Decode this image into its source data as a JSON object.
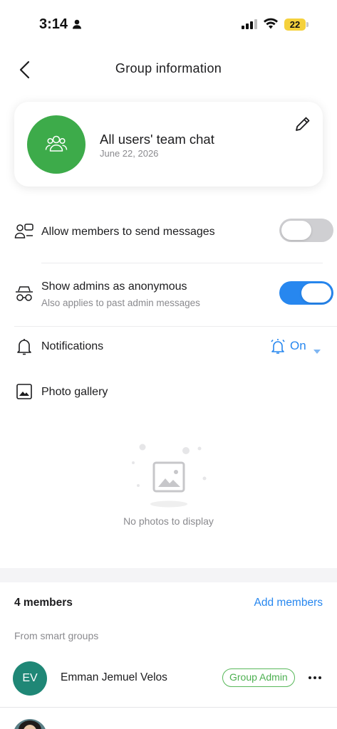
{
  "status_bar": {
    "time": "3:14",
    "battery": "22",
    "icons": [
      "person-icon",
      "signal-icon",
      "wifi-icon",
      "battery-icon"
    ]
  },
  "header": {
    "title": "Group information",
    "back_icon": "chevron-left-icon"
  },
  "group": {
    "name": "All users' team chat",
    "date": "June 22, 2026",
    "avatar_icon": "users-icon",
    "avatar_color": "#3dab4a",
    "edit_icon": "pencil-icon"
  },
  "settings": {
    "allow_messages": {
      "label": "Allow members to send messages",
      "enabled": false
    },
    "anonymous_admins": {
      "label": "Show admins as anonymous",
      "sublabel": "Also applies to past admin messages",
      "enabled": true
    },
    "notifications": {
      "label": "Notifications",
      "value": "On"
    },
    "photo_gallery": {
      "label": "Photo gallery"
    }
  },
  "gallery": {
    "empty_text": "No photos to display"
  },
  "members": {
    "count_label": "4 members",
    "add_label": "Add members",
    "section_label": "From smart groups",
    "list": [
      {
        "initials": "EV",
        "name": "Emman Jemuel Velos",
        "badge": "Group Admin",
        "avatar_color": "#1f8776"
      }
    ]
  },
  "colors": {
    "accent": "#2787ef",
    "admin_badge": "#4caf50"
  }
}
